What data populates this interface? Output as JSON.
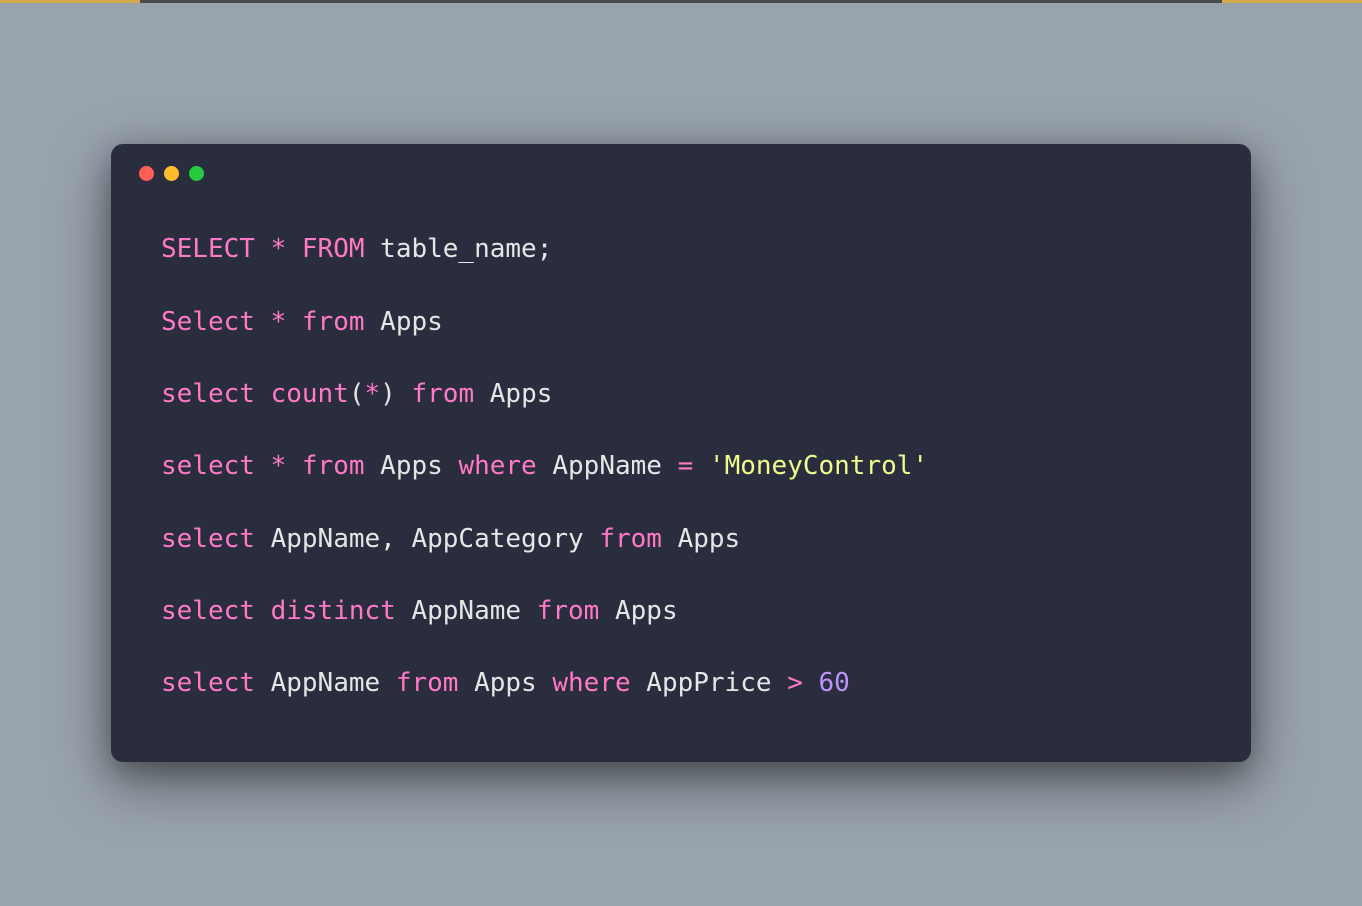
{
  "window": {
    "traffic_lights": [
      "red",
      "yellow",
      "green"
    ]
  },
  "code": {
    "lines": [
      {
        "tokens": [
          {
            "cls": "kw",
            "t": "SELECT"
          },
          {
            "cls": "txt",
            "t": " "
          },
          {
            "cls": "op",
            "t": "*"
          },
          {
            "cls": "txt",
            "t": " "
          },
          {
            "cls": "kw",
            "t": "FROM"
          },
          {
            "cls": "txt",
            "t": " table_name;"
          }
        ]
      },
      {
        "tokens": [
          {
            "cls": "kw",
            "t": "Select"
          },
          {
            "cls": "txt",
            "t": " "
          },
          {
            "cls": "op",
            "t": "*"
          },
          {
            "cls": "txt",
            "t": " "
          },
          {
            "cls": "kw",
            "t": "from"
          },
          {
            "cls": "txt",
            "t": " Apps"
          }
        ]
      },
      {
        "tokens": [
          {
            "cls": "kw",
            "t": "select"
          },
          {
            "cls": "txt",
            "t": " "
          },
          {
            "cls": "fn",
            "t": "count"
          },
          {
            "cls": "paren",
            "t": "("
          },
          {
            "cls": "op",
            "t": "*"
          },
          {
            "cls": "paren",
            "t": ")"
          },
          {
            "cls": "txt",
            "t": " "
          },
          {
            "cls": "kw",
            "t": "from"
          },
          {
            "cls": "txt",
            "t": " Apps"
          }
        ]
      },
      {
        "tokens": [
          {
            "cls": "kw",
            "t": "select"
          },
          {
            "cls": "txt",
            "t": " "
          },
          {
            "cls": "op",
            "t": "*"
          },
          {
            "cls": "txt",
            "t": " "
          },
          {
            "cls": "kw",
            "t": "from"
          },
          {
            "cls": "txt",
            "t": " Apps "
          },
          {
            "cls": "kw",
            "t": "where"
          },
          {
            "cls": "txt",
            "t": " AppName "
          },
          {
            "cls": "op",
            "t": "="
          },
          {
            "cls": "txt",
            "t": " "
          },
          {
            "cls": "str",
            "t": "'MoneyControl'"
          }
        ]
      },
      {
        "tokens": [
          {
            "cls": "kw",
            "t": "select"
          },
          {
            "cls": "txt",
            "t": " AppName, AppCategory "
          },
          {
            "cls": "kw",
            "t": "from"
          },
          {
            "cls": "txt",
            "t": " Apps"
          }
        ]
      },
      {
        "tokens": [
          {
            "cls": "kw",
            "t": "select"
          },
          {
            "cls": "txt",
            "t": " "
          },
          {
            "cls": "kw",
            "t": "distinct"
          },
          {
            "cls": "txt",
            "t": " AppName "
          },
          {
            "cls": "kw",
            "t": "from"
          },
          {
            "cls": "txt",
            "t": " Apps"
          }
        ]
      },
      {
        "tokens": [
          {
            "cls": "kw",
            "t": "select"
          },
          {
            "cls": "txt",
            "t": " AppName "
          },
          {
            "cls": "kw",
            "t": "from"
          },
          {
            "cls": "txt",
            "t": " Apps "
          },
          {
            "cls": "kw",
            "t": "where"
          },
          {
            "cls": "txt",
            "t": " AppPrice "
          },
          {
            "cls": "op",
            "t": ">"
          },
          {
            "cls": "txt",
            "t": " "
          },
          {
            "cls": "num",
            "t": "60"
          }
        ]
      }
    ]
  }
}
